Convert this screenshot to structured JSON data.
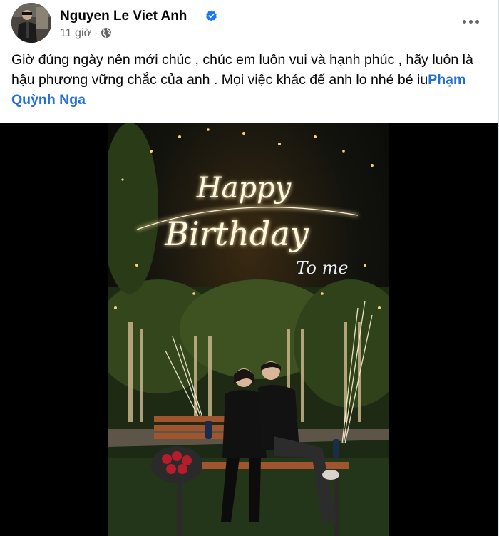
{
  "post": {
    "author": "Nguyen Le Viet Anh",
    "time": "11 giờ",
    "separator": "·",
    "caption_text": "Giờ đúng ngày nên mới chúc , chúc em luôn vui và hạnh phúc , hãy luôn là hậu phương vững chắc của anh . Mọi việc khác để anh lo nhé bé iu",
    "mention": "Phạm Quỳnh Nga"
  },
  "photo": {
    "title_line1": "Happy",
    "title_line2": "Birthday",
    "title_line3": "To me"
  },
  "icons": {
    "verified": "verified-badge-icon",
    "audience": "globe-icon",
    "more": "more-options-icon"
  },
  "colors": {
    "link": "#216fdb",
    "verified": "#1877f2",
    "meta": "#65676b"
  }
}
